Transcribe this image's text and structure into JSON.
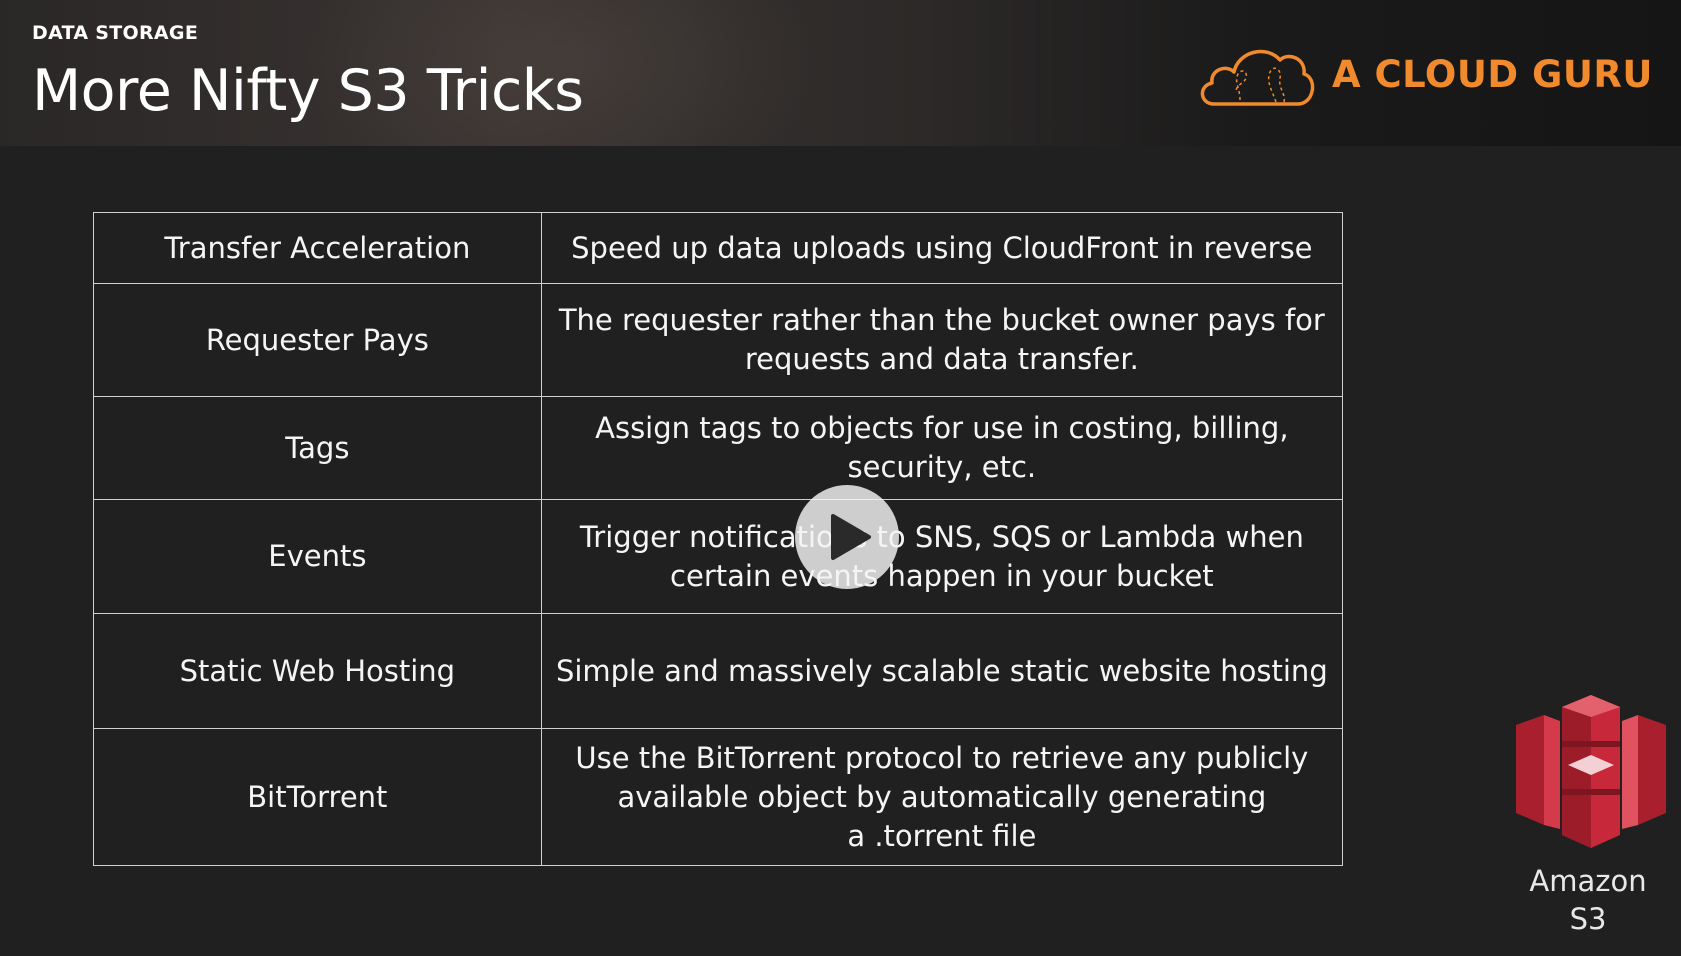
{
  "header": {
    "section_label": "DATA STORAGE",
    "title": "More Nifty S3 Tricks",
    "brand_name": "A CLOUD GURU",
    "brand_color": "#f08a2c"
  },
  "table": {
    "rows": [
      {
        "feature": "Transfer Acceleration",
        "description": [
          "Speed up data uploads using CloudFront in reverse"
        ]
      },
      {
        "feature": "Requester Pays",
        "description": [
          "The requester rather than the bucket owner pays for",
          "requests and data transfer."
        ]
      },
      {
        "feature": "Tags",
        "description": [
          "Assign tags to objects for use in costing, billing,",
          "security, etc."
        ]
      },
      {
        "feature": "Events",
        "description": [
          "Trigger notifications to SNS, SQS or Lambda when",
          "certain events happen in your bucket"
        ]
      },
      {
        "feature": "Static Web Hosting",
        "description": [
          "Simple and massively scalable static website hosting"
        ]
      },
      {
        "feature": "BitTorrent",
        "description": [
          "Use the BitTorrent protocol to retrieve any publicly",
          "available object by automatically generating",
          "a .torrent file"
        ]
      }
    ]
  },
  "s3_logo": {
    "label_line1": "Amazon",
    "label_line2": "S3",
    "color": "#c7283a"
  },
  "player": {
    "play_icon": "play-icon"
  }
}
